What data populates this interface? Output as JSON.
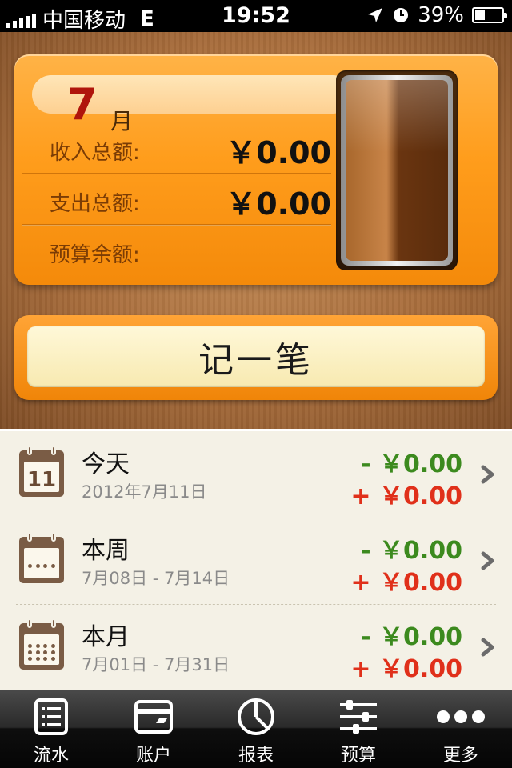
{
  "status_bar": {
    "carrier": "中国移动",
    "network": "E",
    "time": "19:52",
    "battery": "39%",
    "battery_level": 0.39
  },
  "summary": {
    "month_number": "7",
    "month_unit": "月",
    "rows": [
      {
        "label": "收入总额:",
        "value": "￥0.00"
      },
      {
        "label": "支出总额:",
        "value": "￥0.00"
      },
      {
        "label": "预算余额:",
        "value": ""
      }
    ]
  },
  "record_button": {
    "label": "记一笔"
  },
  "list": [
    {
      "title": "今天",
      "subtitle": "2012年7月11日",
      "calendar_day": "11",
      "expense": "- ￥0.00",
      "income": "+ ￥0.00"
    },
    {
      "title": "本周",
      "subtitle": "7月08日 - 7月14日",
      "expense": "- ￥0.00",
      "income": "+ ￥0.00"
    },
    {
      "title": "本月",
      "subtitle": "7月01日 - 7月31日",
      "expense": "- ￥0.00",
      "income": "+ ￥0.00"
    }
  ],
  "tab_bar": [
    {
      "label": "流水",
      "icon": "list-icon"
    },
    {
      "label": "账户",
      "icon": "card-icon"
    },
    {
      "label": "报表",
      "icon": "pie-chart-icon"
    },
    {
      "label": "预算",
      "icon": "sliders-icon"
    },
    {
      "label": "更多",
      "icon": "more-icon"
    }
  ],
  "colors": {
    "expense": "#3c8a1e",
    "income": "#e0301a",
    "accent": "#ff9d1c"
  }
}
